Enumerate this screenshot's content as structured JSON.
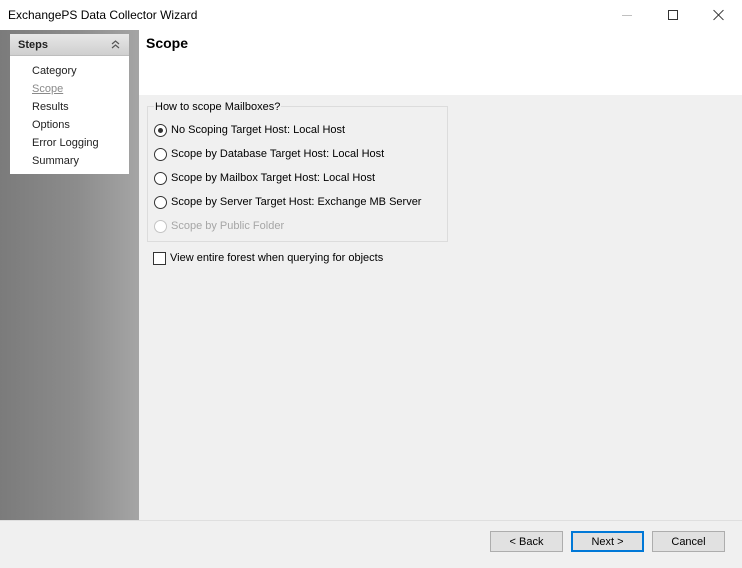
{
  "window": {
    "title": "ExchangePS Data Collector Wizard"
  },
  "steps": {
    "header": "Steps",
    "items": [
      {
        "label": "Category",
        "current": false
      },
      {
        "label": "Scope",
        "current": true
      },
      {
        "label": "Results",
        "current": false
      },
      {
        "label": "Options",
        "current": false
      },
      {
        "label": "Error Logging",
        "current": false
      },
      {
        "label": "Summary",
        "current": false
      }
    ]
  },
  "page": {
    "title": "Scope"
  },
  "scope_group": {
    "legend": "How to scope Mailboxes?",
    "options": [
      {
        "label": "No Scoping Target Host: Local Host",
        "checked": true,
        "enabled": true
      },
      {
        "label": "Scope by Database Target Host: Local Host",
        "checked": false,
        "enabled": true
      },
      {
        "label": "Scope by Mailbox Target Host: Local Host",
        "checked": false,
        "enabled": true
      },
      {
        "label": "Scope by Server Target Host: Exchange MB Server",
        "checked": false,
        "enabled": true
      },
      {
        "label": "Scope by Public Folder",
        "checked": false,
        "enabled": false
      }
    ]
  },
  "forest_checkbox": {
    "label": "View entire forest when querying for objects",
    "checked": false
  },
  "footer": {
    "back_label": "< Back",
    "next_label": "Next >",
    "cancel_label": "Cancel"
  },
  "colors": {
    "accent_focus": "#0078d7",
    "disabled_text": "#a6a6a6"
  }
}
